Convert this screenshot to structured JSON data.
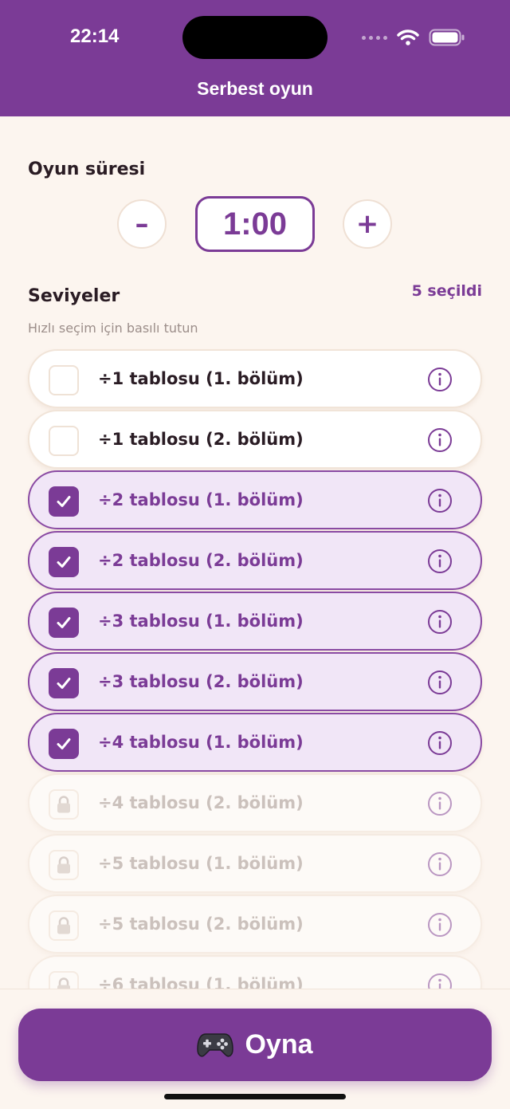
{
  "status_bar": {
    "time": "22:14",
    "icons": [
      "signal-dots-icon",
      "wifi-icon",
      "battery-icon"
    ]
  },
  "header": {
    "title": "Serbest oyun"
  },
  "duration": {
    "label": "Oyun süresi",
    "decrement_label": "–",
    "increment_label": "+",
    "value": "1:00"
  },
  "levels": {
    "label": "Seviyeler",
    "selected_count": "5 seçildi",
    "hint": "Hızlı seçim için basılı tutun",
    "items": [
      {
        "label": "÷1 tablosu (1. bölüm)",
        "state": "unchecked"
      },
      {
        "label": "÷1 tablosu (2. bölüm)",
        "state": "unchecked"
      },
      {
        "label": "÷2 tablosu (1. bölüm)",
        "state": "checked"
      },
      {
        "label": "÷2 tablosu (2. bölüm)",
        "state": "checked"
      },
      {
        "label": "÷3 tablosu (1. bölüm)",
        "state": "checked"
      },
      {
        "label": "÷3 tablosu (2. bölüm)",
        "state": "checked"
      },
      {
        "label": "÷4 tablosu (1. bölüm)",
        "state": "checked"
      },
      {
        "label": "÷4 tablosu (2. bölüm)",
        "state": "locked"
      },
      {
        "label": "÷5 tablosu (1. bölüm)",
        "state": "locked"
      },
      {
        "label": "÷5 tablosu (2. bölüm)",
        "state": "locked"
      },
      {
        "label": "÷6 tablosu (1. bölüm)",
        "state": "locked"
      }
    ]
  },
  "play_button": {
    "icon": "gamepad-icon",
    "label": "Oyna"
  },
  "colors": {
    "accent": "#7b3b96",
    "background": "#fcf5ef",
    "selected_row": "#f1e6f7"
  }
}
